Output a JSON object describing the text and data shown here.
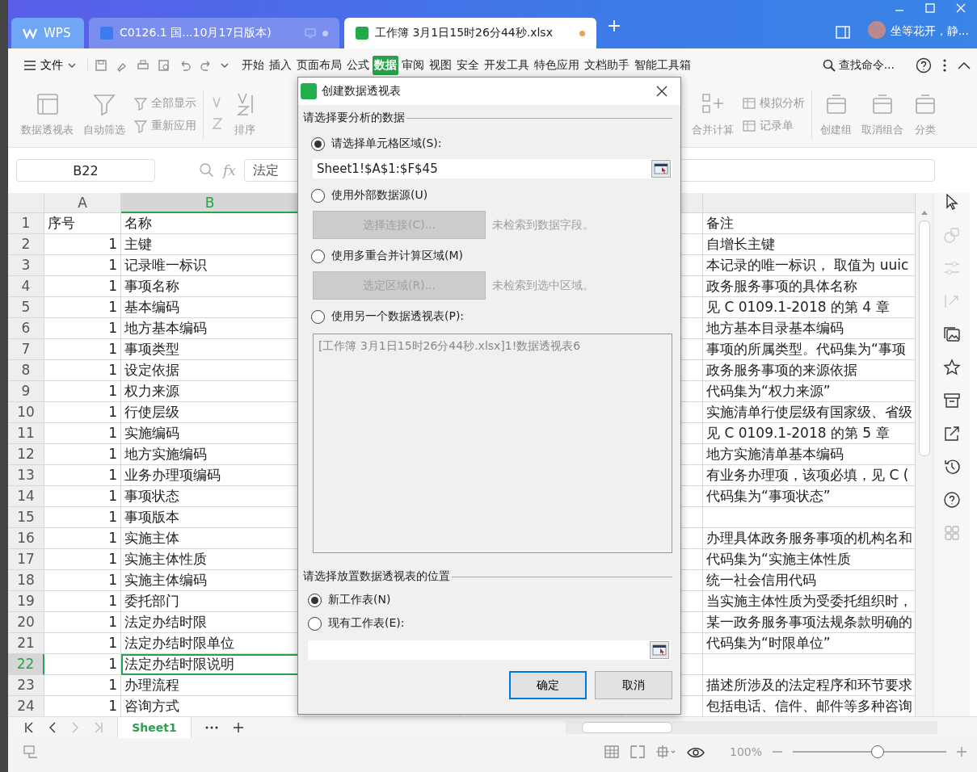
{
  "tabs": [
    {
      "label": "WPS",
      "kind": "home",
      "selected": false
    },
    {
      "label": "C0126.1 国...10月17日版本)",
      "kind": "writer",
      "selected": false
    },
    {
      "label": "工作簿 3月1日15时26分44秒.xlsx",
      "kind": "sheet",
      "selected": true
    }
  ],
  "user": {
    "name": "坐等花开，静..."
  },
  "menu": {
    "file": "文件",
    "items": [
      {
        "label": "开始",
        "selected": false
      },
      {
        "label": "插入",
        "selected": false
      },
      {
        "label": "页面布局",
        "selected": false
      },
      {
        "label": "公式",
        "selected": false
      },
      {
        "label": "数据",
        "selected": true
      },
      {
        "label": "审阅",
        "selected": false
      },
      {
        "label": "视图",
        "selected": false
      },
      {
        "label": "安全",
        "selected": false
      },
      {
        "label": "开发工具",
        "selected": false
      },
      {
        "label": "特色应用",
        "selected": false
      },
      {
        "label": "文档助手",
        "selected": false
      },
      {
        "label": "智能工具箱",
        "selected": false
      }
    ],
    "search": "查找命令..."
  },
  "ribbon": {
    "left": [
      "数据透视表",
      "自动筛选"
    ],
    "filter_small": [
      "全部显示",
      "重新应用"
    ],
    "sort": "排序",
    "right_big": "合并计算",
    "right_small": [
      "模拟分析",
      "记录单"
    ],
    "groups": [
      "创建组",
      "取消组合",
      "分类"
    ]
  },
  "formula_bar": {
    "name_box": "B22",
    "formula": "法定",
    "fx": "fx"
  },
  "grid": {
    "columns": [
      "A",
      "B"
    ],
    "rows": [
      {
        "n": "1",
        "a": "序号",
        "b": "名称",
        "f": "备注",
        "selected": false
      },
      {
        "n": "2",
        "a": "1",
        "b": "主键",
        "f": "自增长主键",
        "selected": false
      },
      {
        "n": "3",
        "a": "1",
        "b": "记录唯一标识",
        "f": "本记录的唯一标识， 取值为 uuic",
        "selected": false
      },
      {
        "n": "4",
        "a": "1",
        "b": "事项名称",
        "f": "政务服务事项的具体名称",
        "selected": false
      },
      {
        "n": "5",
        "a": "1",
        "b": "基本编码",
        "f": "见 C 0109.1-2018 的第 4 章",
        "selected": false
      },
      {
        "n": "6",
        "a": "1",
        "b": "地方基本编码",
        "f": "地方基本目录基本编码",
        "selected": false
      },
      {
        "n": "7",
        "a": "1",
        "b": "事项类型",
        "f": "事项的所属类型。代码集为“事项",
        "selected": false
      },
      {
        "n": "8",
        "a": "1",
        "b": "设定依据",
        "f": "政务服务事项的来源依据",
        "selected": false
      },
      {
        "n": "9",
        "a": "1",
        "b": "权力来源",
        "f": "代码集为“权力来源”",
        "selected": false
      },
      {
        "n": "10",
        "a": "1",
        "b": "行使层级",
        "f": "实施清单行使层级有国家级、省级",
        "selected": false
      },
      {
        "n": "11",
        "a": "1",
        "b": "实施编码",
        "f": "见 C 0109.1-2018 的第 5 章",
        "selected": false
      },
      {
        "n": "12",
        "a": "1",
        "b": "地方实施编码",
        "f": "地方实施清单基本编码",
        "selected": false
      },
      {
        "n": "13",
        "a": "1",
        "b": "业务办理项编码",
        "f": "有业务办理项，该项必填，见 C (",
        "selected": false
      },
      {
        "n": "14",
        "a": "1",
        "b": "事项状态",
        "f": "代码集为“事项状态”",
        "selected": false
      },
      {
        "n": "15",
        "a": "1",
        "b": "事项版本",
        "selected": false
      },
      {
        "n": "16",
        "a": "1",
        "b": "实施主体",
        "f": "办理具体政务服务事项的机构名和",
        "selected": false
      },
      {
        "n": "17",
        "a": "1",
        "b": "实施主体性质",
        "f": "代码集为“实施主体性质",
        "selected": false
      },
      {
        "n": "18",
        "a": "1",
        "b": "实施主体编码",
        "f": "统一社会信用代码",
        "selected": false
      },
      {
        "n": "19",
        "a": "1",
        "b": "委托部门",
        "f": "当实施主体性质为受委托组织时，",
        "selected": false
      },
      {
        "n": "20",
        "a": "1",
        "b": "法定办结时限",
        "f": "某一政务服务事项法规条款明确的",
        "selected": false
      },
      {
        "n": "21",
        "a": "1",
        "b": "法定办结时限单位",
        "f": "代码集为“时限单位”",
        "selected": false
      },
      {
        "n": "22",
        "a": "1",
        "b": "法定办结时限说明",
        "selected": true
      },
      {
        "n": "23",
        "a": "1",
        "b": "办理流程",
        "f": "描述所涉及的法定程序和环节要求",
        "selected": false
      },
      {
        "n": "24",
        "a": "1",
        "b": "咨询方式",
        "f": "包括电话、信件、邮件等多种咨询",
        "selected": false
      }
    ]
  },
  "dialog": {
    "title": "创建数据透视表",
    "section_source": "请选择要分析的数据",
    "sources": [
      {
        "label": "请选择单元格区域(S):",
        "selected": true,
        "kind": "range",
        "value": "Sheet1!$A$1:$F$45"
      },
      {
        "label": "使用外部数据源(U)",
        "selected": false,
        "kind": "button",
        "button": "选择连接(C)...",
        "hint": "未检索到数据字段。",
        "disabled": true
      },
      {
        "label": "使用多重合并计算区域(M)",
        "selected": false,
        "kind": "button",
        "button": "选定区域(R)...",
        "hint": "未检索到选中区域。",
        "disabled": true
      },
      {
        "label": "使用另一个数据透视表(P):",
        "selected": false,
        "kind": "list",
        "items": [
          "[工作簿 3月1日15时26分44秒.xlsx]1!数据透视表6"
        ]
      }
    ],
    "section_place": "请选择放置数据透视表的位置",
    "places": [
      {
        "label": "新工作表(N)",
        "selected": true
      },
      {
        "label": "现有工作表(E):",
        "selected": false
      }
    ],
    "ok": "确定",
    "cancel": "取消"
  },
  "sheets": [
    {
      "label": "Sheet1",
      "selected": true
    }
  ],
  "status": {
    "zoom": "100%",
    "level": 0.55
  }
}
